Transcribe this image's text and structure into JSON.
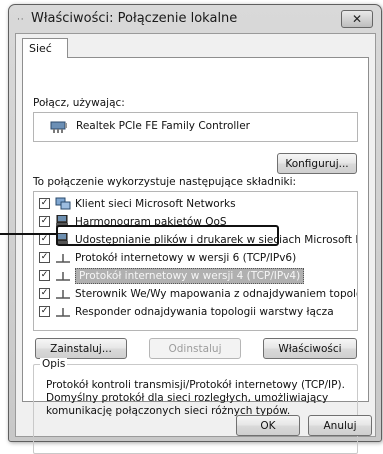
{
  "window": {
    "title": "Właściwości: Połączenie lokalne",
    "close_glyph": "✕"
  },
  "tabs": [
    {
      "label": "Sieć"
    }
  ],
  "connect_using": {
    "label": "Połącz, używając:",
    "adapter_name": "Realtek PCIe FE Family Controller",
    "adapter_icon": "network-adapter-icon",
    "configure_label": "Konfiguruj..."
  },
  "components": {
    "label": "To połączenie wykorzystuje następujące składniki:",
    "items": [
      {
        "label": "Klient sieci Microsoft Networks",
        "checked": true,
        "icon": "client-network-icon",
        "selected": false
      },
      {
        "label": "Harmonogram pakietów QoS",
        "checked": true,
        "icon": "service-icon",
        "selected": false
      },
      {
        "label": "Udostępnianie plików i drukarek w sieciach Microsoft Networks",
        "checked": true,
        "icon": "service-icon",
        "selected": false
      },
      {
        "label": "Protokół internetowy w wersji 6 (TCP/IPv6)",
        "checked": true,
        "icon": "protocol-icon",
        "selected": false
      },
      {
        "label": "Protokół internetowy w wersji 4 (TCP/IPv4)",
        "checked": true,
        "icon": "protocol-icon",
        "selected": true
      },
      {
        "label": "Sterownik We/Wy mapowania z odnajdywaniem topologii wa...",
        "checked": true,
        "icon": "protocol-icon",
        "selected": false
      },
      {
        "label": "Responder odnajdywania topologii warstwy łącza",
        "checked": true,
        "icon": "protocol-icon",
        "selected": false
      }
    ],
    "check_glyph": "✓"
  },
  "buttons": {
    "install": "Zainstaluj...",
    "uninstall": "Odinstaluj",
    "properties": "Właściwości",
    "ok": "OK",
    "cancel": "Anuluj"
  },
  "description": {
    "legend": "Opis",
    "lines": [
      "Protokół kontroli transmisji/Protokół internetowy (TCP/IP).",
      "Domyślny protokół dla sieci rozległych, umożliwiający",
      "komunikację połączonych sieci różnych typów."
    ]
  },
  "colors": {
    "selection": "#b0b0b0",
    "window_frame": "#c8c8c8"
  }
}
